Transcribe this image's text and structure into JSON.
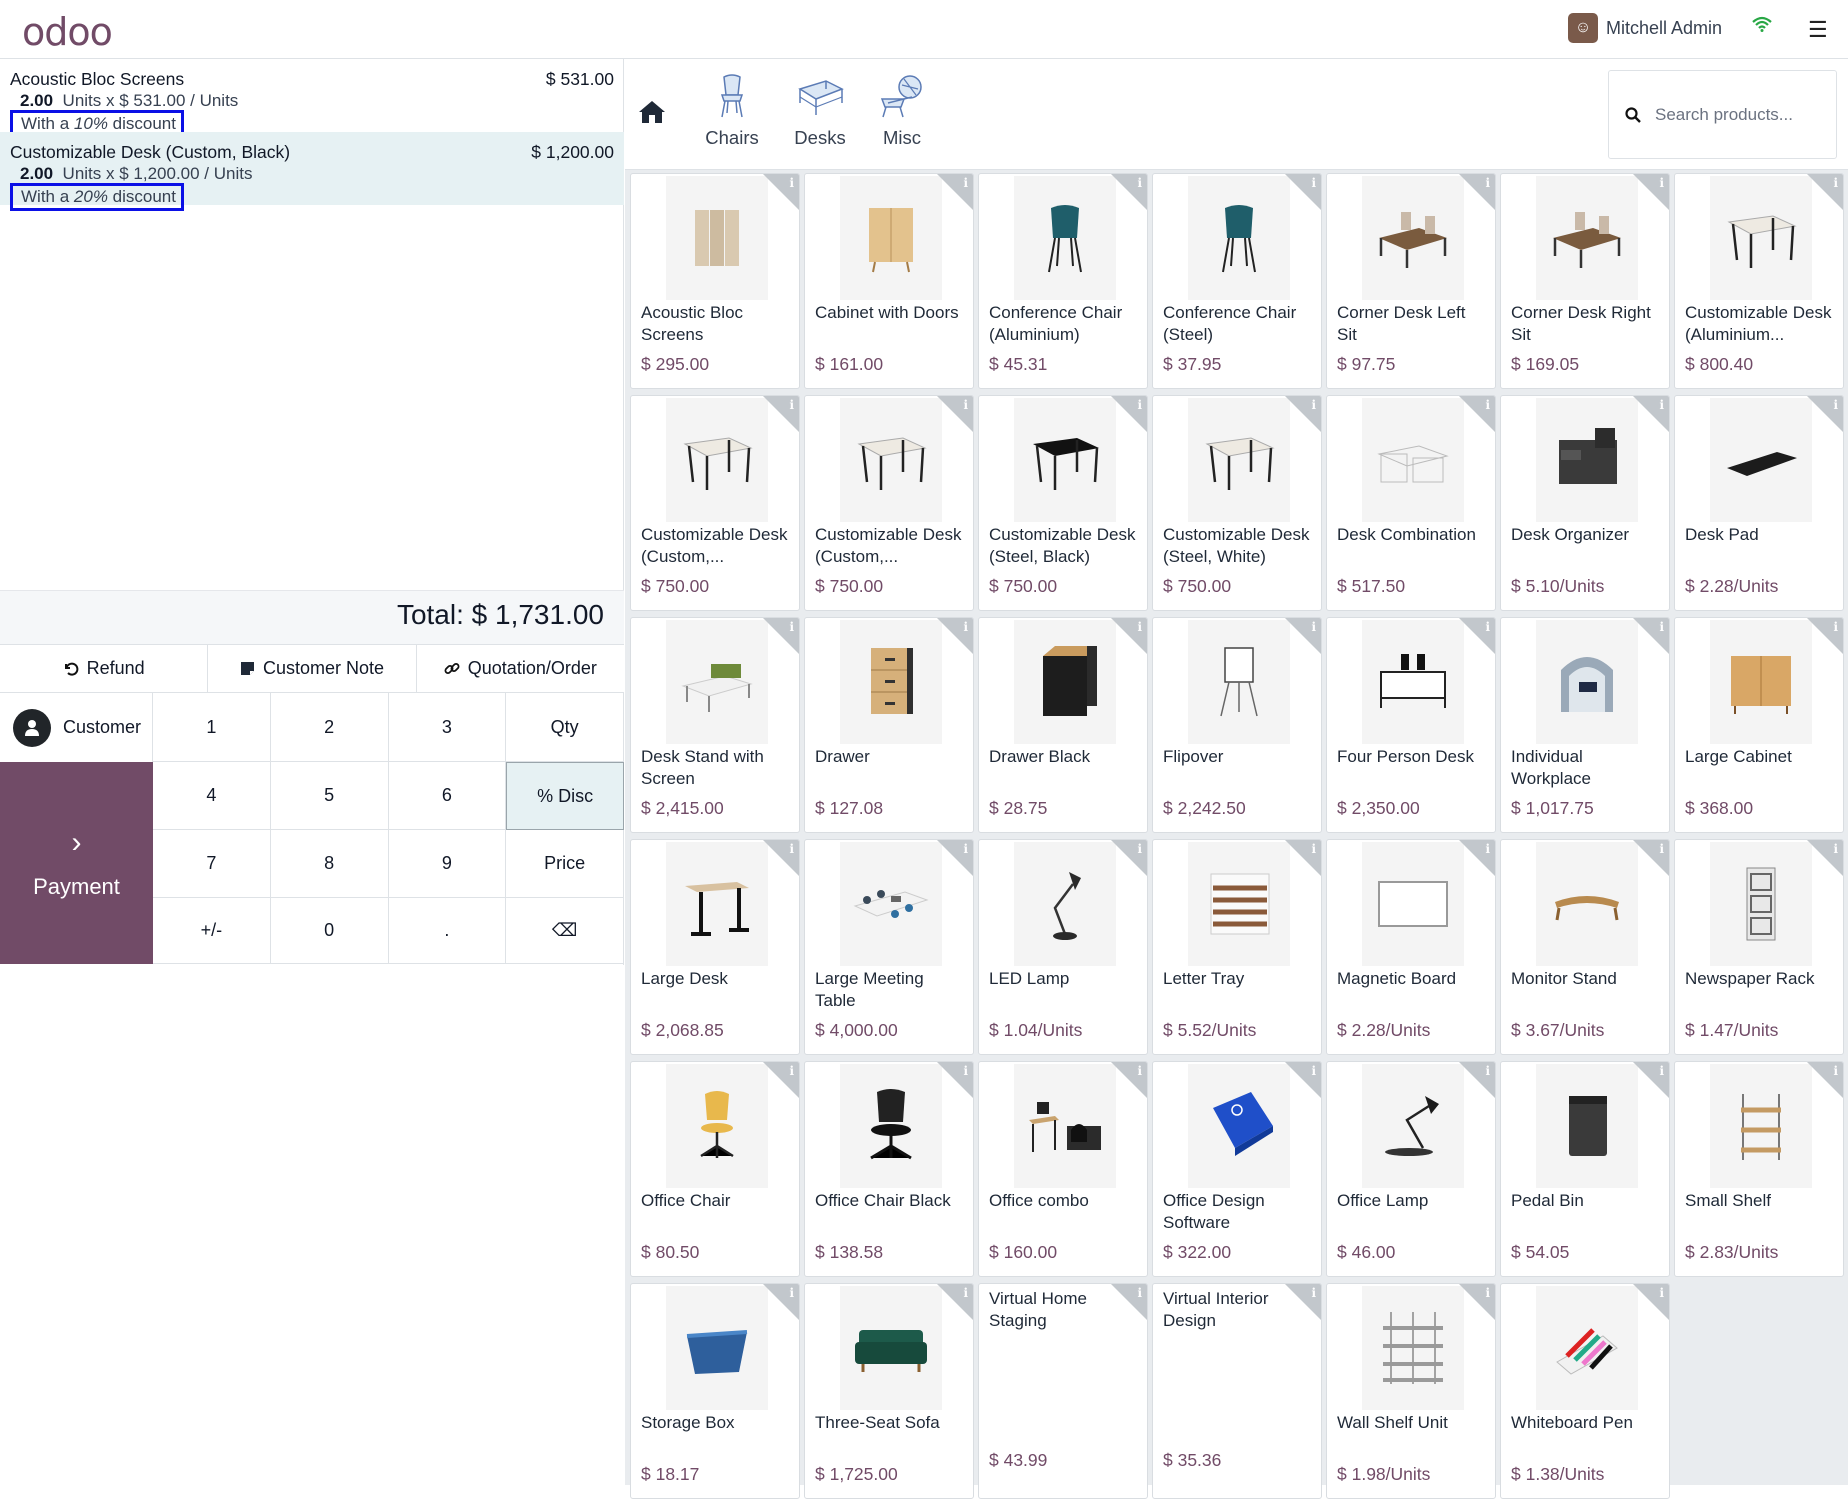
{
  "app": {
    "logo_main": "odoo",
    "user_name": "Mitchell Admin"
  },
  "order": {
    "lines": [
      {
        "name": "Acoustic Bloc Screens",
        "price": "$ 531.00",
        "qty": "2.00",
        "unit_text": "Units x $ 531.00 / Units",
        "disc_pre": "With a ",
        "disc_val": "10%",
        "disc_post": " discount"
      },
      {
        "name": "Customizable Desk (Custom, Black)",
        "price": "$ 1,200.00",
        "qty": "2.00",
        "unit_text": "Units x $ 1,200.00 / Units",
        "disc_pre": "With a ",
        "disc_val": "20%",
        "disc_post": " discount"
      }
    ],
    "total": "Total: $ 1,731.00"
  },
  "actions": {
    "refund": "Refund",
    "customer_note": "Customer Note",
    "quotation": "Quotation/Order"
  },
  "pad": {
    "customer": "Customer",
    "payment": "Payment",
    "keys": [
      "1",
      "2",
      "3",
      "Qty",
      "4",
      "5",
      "6",
      "% Disc",
      "7",
      "8",
      "9",
      "Price",
      "+/-",
      "0",
      ".",
      "⌫"
    ]
  },
  "categories": [
    {
      "label": "Chairs"
    },
    {
      "label": "Desks"
    },
    {
      "label": "Misc"
    }
  ],
  "search": {
    "placeholder": "Search products..."
  },
  "colors": {
    "brand": "#714B67",
    "selected": "#e6f1f3",
    "highlight_border": "#0b10e6"
  },
  "products": [
    {
      "name": "Acoustic Bloc Screens",
      "price": "$ 295.00",
      "icon": "screen"
    },
    {
      "name": "Cabinet with Doors",
      "price": "$ 161.00",
      "icon": "cabinet"
    },
    {
      "name": "Conference Chair (Aluminium)",
      "price": "$ 45.31",
      "icon": "chair-teal"
    },
    {
      "name": "Conference Chair (Steel)",
      "price": "$ 37.95",
      "icon": "chair-teal"
    },
    {
      "name": "Corner Desk Left Sit",
      "price": "$ 97.75",
      "icon": "corner-desk"
    },
    {
      "name": "Corner Desk Right Sit",
      "price": "$ 169.05",
      "icon": "corner-desk"
    },
    {
      "name": "Customizable Desk (Aluminium...",
      "price": "$ 800.40",
      "icon": "desk-white"
    },
    {
      "name": "Customizable Desk (Custom,...",
      "price": "$ 750.00",
      "icon": "desk-white"
    },
    {
      "name": "Customizable Desk (Custom,...",
      "price": "$ 750.00",
      "icon": "desk-white"
    },
    {
      "name": "Customizable Desk (Steel, Black)",
      "price": "$ 750.00",
      "icon": "desk-black"
    },
    {
      "name": "Customizable Desk (Steel, White)",
      "price": "$ 750.00",
      "icon": "desk-white"
    },
    {
      "name": "Desk Combination",
      "price": "$ 517.50",
      "icon": "desk-combo"
    },
    {
      "name": "Desk Organizer",
      "price": "$ 5.10/Units",
      "icon": "organizer"
    },
    {
      "name": "Desk Pad",
      "price": "$ 2.28/Units",
      "icon": "deskpad"
    },
    {
      "name": "Desk Stand with Screen",
      "price": "$ 2,415.00",
      "icon": "stand"
    },
    {
      "name": "Drawer",
      "price": "$ 127.08",
      "icon": "drawer"
    },
    {
      "name": "Drawer Black",
      "price": "$ 28.75",
      "icon": "drawer-black"
    },
    {
      "name": "Flipover",
      "price": "$ 2,242.50",
      "icon": "flipover"
    },
    {
      "name": "Four Person Desk",
      "price": "$ 2,350.00",
      "icon": "four-desk"
    },
    {
      "name": "Individual Workplace",
      "price": "$ 1,017.75",
      "icon": "pod"
    },
    {
      "name": "Large Cabinet",
      "price": "$ 368.00",
      "icon": "large-cabinet"
    },
    {
      "name": "Large Desk",
      "price": "$ 2,068.85",
      "icon": "large-desk"
    },
    {
      "name": "Large Meeting Table",
      "price": "$ 4,000.00",
      "icon": "meeting"
    },
    {
      "name": "LED Lamp",
      "price": "$ 1.04/Units",
      "icon": "lamp"
    },
    {
      "name": "Letter Tray",
      "price": "$ 5.52/Units",
      "icon": "tray"
    },
    {
      "name": "Magnetic Board",
      "price": "$ 2.28/Units",
      "icon": "board"
    },
    {
      "name": "Monitor Stand",
      "price": "$ 3.67/Units",
      "icon": "monitor-stand"
    },
    {
      "name": "Newspaper Rack",
      "price": "$ 1.47/Units",
      "icon": "rack"
    },
    {
      "name": "Office Chair",
      "price": "$ 80.50",
      "icon": "office-chair"
    },
    {
      "name": "Office Chair Black",
      "price": "$ 138.58",
      "icon": "office-chair-black"
    },
    {
      "name": "Office combo",
      "price": "$ 160.00",
      "icon": "combo"
    },
    {
      "name": "Office Design Software",
      "price": "$ 322.00",
      "icon": "software"
    },
    {
      "name": "Office Lamp",
      "price": "$ 46.00",
      "icon": "office-lamp"
    },
    {
      "name": "Pedal Bin",
      "price": "$ 54.05",
      "icon": "bin"
    },
    {
      "name": "Small Shelf",
      "price": "$ 2.83/Units",
      "icon": "shelf"
    },
    {
      "name": "Storage Box",
      "price": "$ 18.17",
      "icon": "box"
    },
    {
      "name": "Three-Seat Sofa",
      "price": "$ 1,725.00",
      "icon": "sofa"
    },
    {
      "name": "Virtual Home Staging",
      "price": "$ 43.99",
      "icon": "none"
    },
    {
      "name": "Virtual Interior Design",
      "price": "$ 35.36",
      "icon": "none"
    },
    {
      "name": "Wall Shelf Unit",
      "price": "$ 1.98/Units",
      "icon": "wall-shelf"
    },
    {
      "name": "Whiteboard Pen",
      "price": "$ 1.38/Units",
      "icon": "pens"
    }
  ]
}
